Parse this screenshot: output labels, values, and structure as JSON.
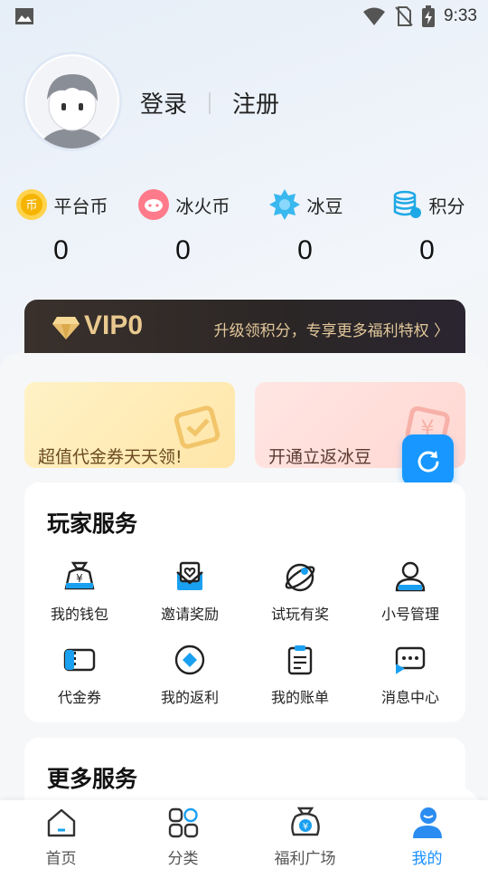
{
  "status_bar": {
    "time": "9:33"
  },
  "auth": {
    "login": "登录",
    "register": "注册"
  },
  "currencies": [
    {
      "label": "平台币",
      "value": "0",
      "icon": "coin-icon"
    },
    {
      "label": "冰火币",
      "value": "0",
      "icon": "fire-coin-icon"
    },
    {
      "label": "冰豆",
      "value": "0",
      "icon": "ice-bean-icon"
    },
    {
      "label": "积分",
      "value": "0",
      "icon": "points-icon"
    }
  ],
  "vip": {
    "level": "VIP0",
    "promo": "升级领积分，专享更多福利特权 〉"
  },
  "promos": [
    {
      "text": "超值代金券天天领!"
    },
    {
      "text": "开通立返冰豆"
    }
  ],
  "services": {
    "title": "玩家服务",
    "items": [
      {
        "label": "我的钱包",
        "icon": "wallet-icon"
      },
      {
        "label": "邀请奖励",
        "icon": "invite-icon"
      },
      {
        "label": "试玩有奖",
        "icon": "trial-icon"
      },
      {
        "label": "小号管理",
        "icon": "account-icon"
      },
      {
        "label": "代金券",
        "icon": "voucher-icon"
      },
      {
        "label": "我的返利",
        "icon": "rebate-icon"
      },
      {
        "label": "我的账单",
        "icon": "bill-icon"
      },
      {
        "label": "消息中心",
        "icon": "message-icon"
      }
    ]
  },
  "more_services": {
    "title": "更多服务"
  },
  "nav": [
    {
      "label": "首页",
      "icon": "home-icon"
    },
    {
      "label": "分类",
      "icon": "category-icon"
    },
    {
      "label": "福利广场",
      "icon": "welfare-icon"
    },
    {
      "label": "我的",
      "icon": "profile-icon",
      "active": true
    }
  ],
  "colors": {
    "accent": "#1890ff",
    "vip_gold": "#e9c98f",
    "vip_bg": "#2b2626"
  }
}
